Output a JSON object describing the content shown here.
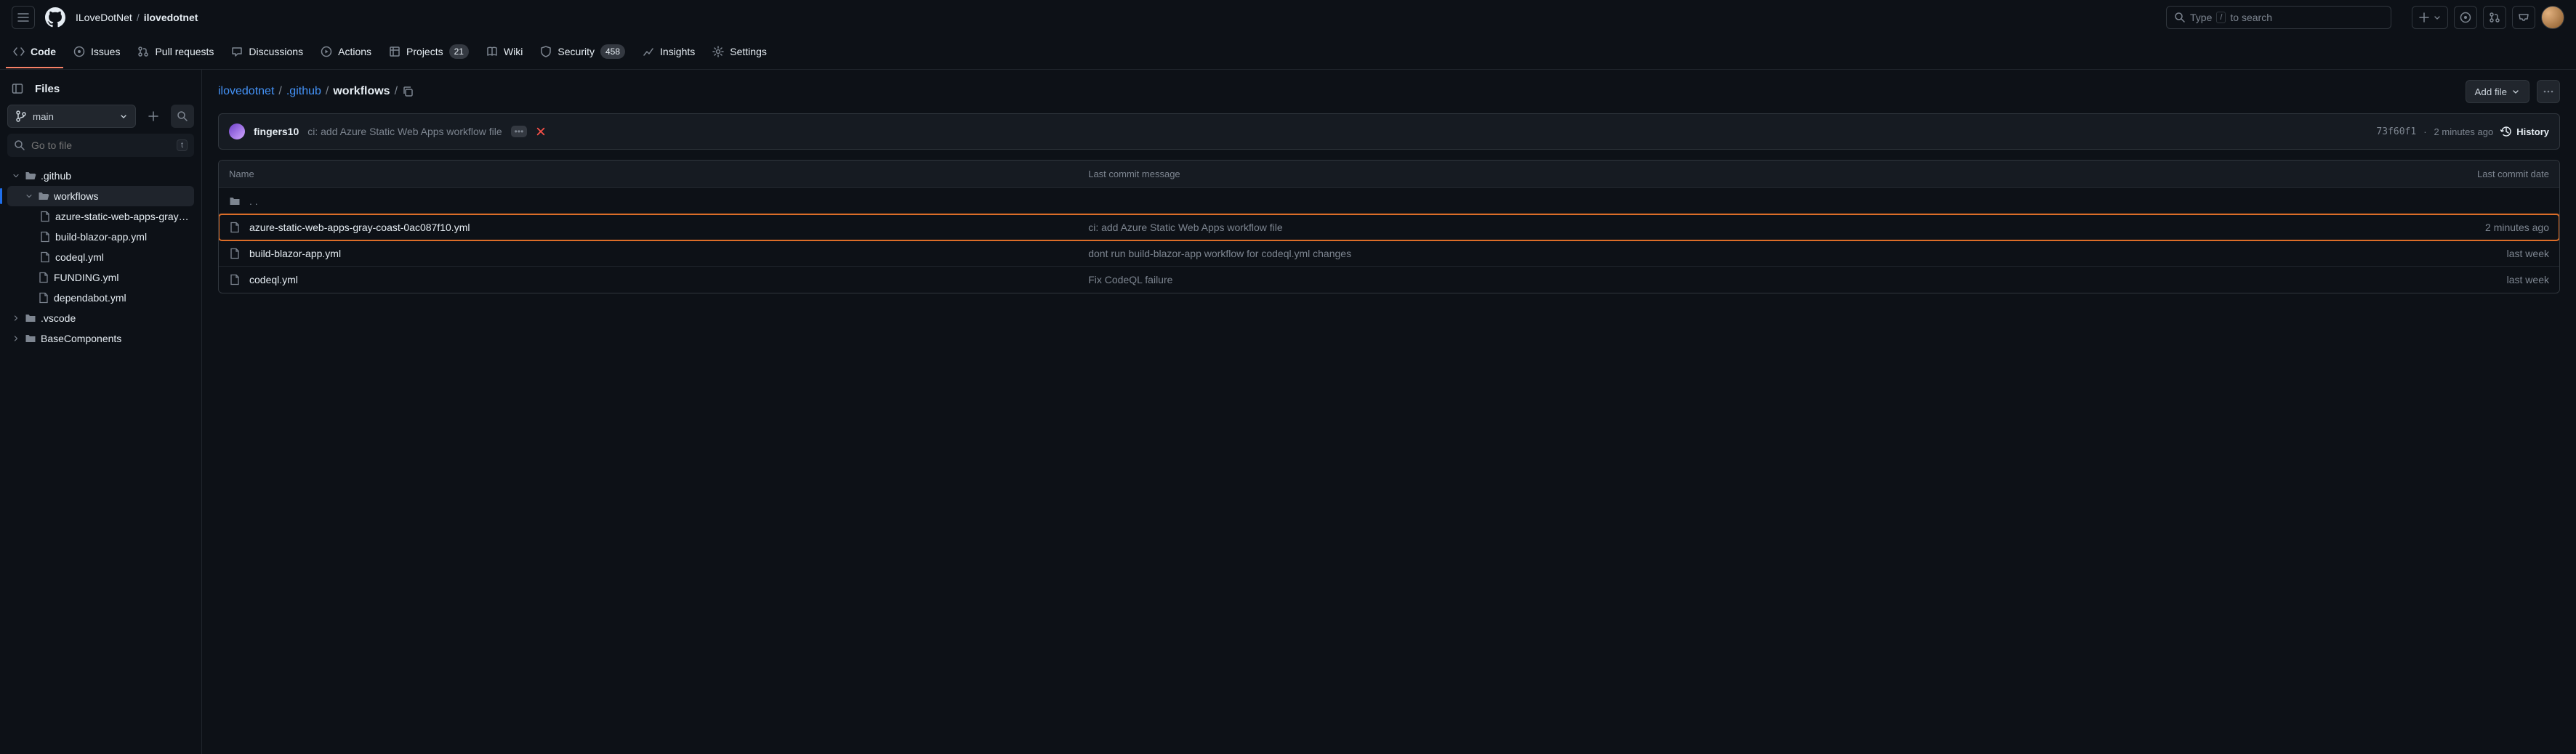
{
  "header": {
    "owner": "ILoveDotNet",
    "sep": "/",
    "repo": "ilovedotnet",
    "search_prefix": "Type",
    "search_key": "/",
    "search_suffix": "to search"
  },
  "nav": {
    "code": "Code",
    "issues": "Issues",
    "pulls": "Pull requests",
    "actions": "Actions",
    "projects": "Projects",
    "projects_count": "21",
    "wiki": "Wiki",
    "security": "Security",
    "security_count": "458",
    "insights": "Insights",
    "settings": "Settings"
  },
  "sidebar": {
    "title": "Files",
    "branch": "main",
    "filter_placeholder": "Go to file",
    "filter_key": "t",
    "tree": {
      "github": ".github",
      "workflows": "workflows",
      "file_azure": "azure-static-web-apps-gray-c...",
      "file_build": "build-blazor-app.yml",
      "file_codeql": "codeql.yml",
      "file_funding": "FUNDING.yml",
      "file_dependabot": "dependabot.yml",
      "vscode": ".vscode",
      "basecomponents": "BaseComponents"
    }
  },
  "breadcrumb": {
    "root": "ilovedotnet",
    "github": ".github",
    "workflows": "workflows",
    "sep": "/"
  },
  "actions": {
    "add_file": "Add file"
  },
  "commit": {
    "author": "fingers10",
    "message": "ci: add Azure Static Web Apps workflow file",
    "badge": "•••",
    "hash": "73f60f1",
    "dot": "·",
    "time": "2 minutes ago",
    "history": "History"
  },
  "table": {
    "head": {
      "name": "Name",
      "msg": "Last commit message",
      "date": "Last commit date"
    },
    "updir": ". .",
    "rows": [
      {
        "name": "azure-static-web-apps-gray-coast-0ac087f10.yml",
        "msg": "ci: add Azure Static Web Apps workflow file",
        "date": "2 minutes ago",
        "highlight": true
      },
      {
        "name": "build-blazor-app.yml",
        "msg": "dont run build-blazor-app workflow for codeql.yml changes",
        "date": "last week",
        "highlight": false
      },
      {
        "name": "codeql.yml",
        "msg": "Fix CodeQL failure",
        "date": "last week",
        "highlight": false
      }
    ]
  }
}
